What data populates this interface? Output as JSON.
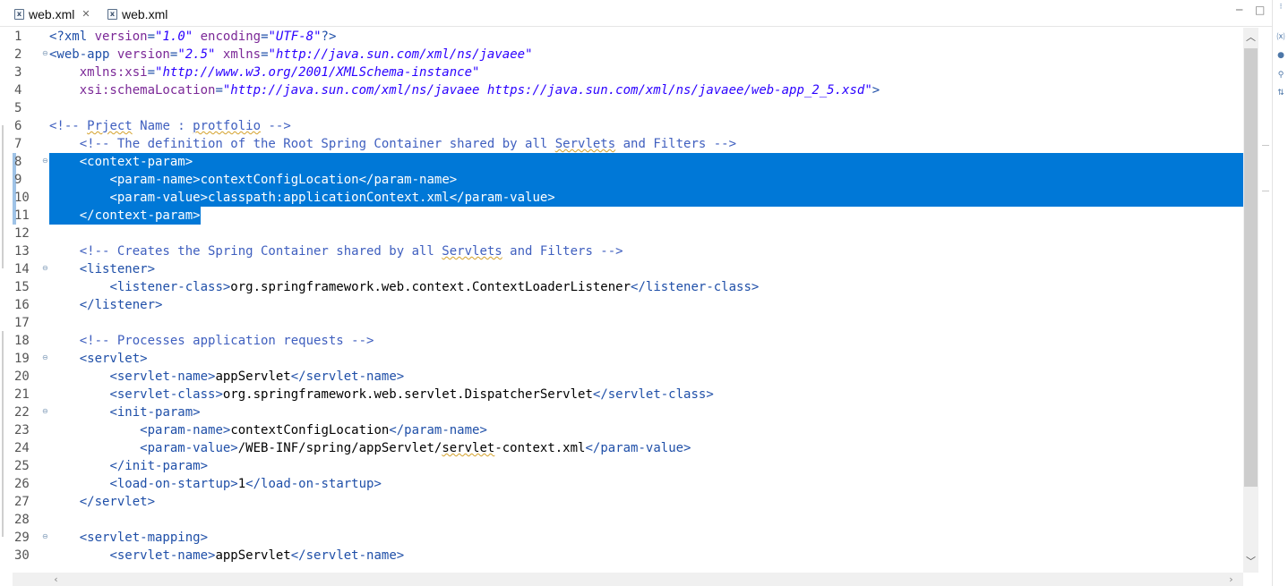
{
  "tabs": [
    {
      "label": "web.xml",
      "active": true,
      "close_icon": "✕"
    },
    {
      "label": "web.xml",
      "active": false
    }
  ],
  "window_controls": {
    "minimize": "─",
    "maximize": "□"
  },
  "editor": {
    "selection_color": "#0078d7",
    "lines": [
      {
        "num": "1",
        "fold": false,
        "selected": false,
        "tokens": [
          [
            "tag",
            "<?xml "
          ],
          [
            "attr",
            "version"
          ],
          [
            "tag",
            "="
          ],
          [
            "val",
            "\"1.0\""
          ],
          [
            "tag",
            " "
          ],
          [
            "attr",
            "encoding"
          ],
          [
            "tag",
            "="
          ],
          [
            "val",
            "\"UTF-8\""
          ],
          [
            "tag",
            "?>"
          ]
        ]
      },
      {
        "num": "2",
        "fold": true,
        "selected": false,
        "tokens": [
          [
            "tag",
            "<web-app "
          ],
          [
            "attr",
            "version"
          ],
          [
            "tag",
            "="
          ],
          [
            "val",
            "\"2.5\""
          ],
          [
            "tag",
            " "
          ],
          [
            "attr",
            "xmlns"
          ],
          [
            "tag",
            "="
          ],
          [
            "val",
            "\"http://java.sun.com/xml/ns/javaee\""
          ]
        ]
      },
      {
        "num": "3",
        "fold": false,
        "selected": false,
        "tokens": [
          [
            "txt",
            "    "
          ],
          [
            "attr",
            "xmlns:xsi"
          ],
          [
            "tag",
            "="
          ],
          [
            "val",
            "\"http://www.w3.org/2001/XMLSchema-instance\""
          ]
        ]
      },
      {
        "num": "4",
        "fold": false,
        "selected": false,
        "tokens": [
          [
            "txt",
            "    "
          ],
          [
            "attr",
            "xsi:schemaLocation"
          ],
          [
            "tag",
            "="
          ],
          [
            "val",
            "\"http://java.sun.com/xml/ns/javaee https://java.sun.com/xml/ns/javaee/web-app_2_5.xsd\""
          ],
          [
            "tag",
            ">"
          ]
        ]
      },
      {
        "num": "5",
        "fold": false,
        "selected": false,
        "tokens": []
      },
      {
        "num": "6",
        "fold": false,
        "selected": false,
        "tokens": [
          [
            "cmt",
            "<!-- "
          ],
          [
            "cmt-sq",
            "Prject"
          ],
          [
            "cmt",
            " Name : "
          ],
          [
            "cmt-sq",
            "protfolio"
          ],
          [
            "cmt",
            " -->"
          ]
        ]
      },
      {
        "num": "7",
        "fold": false,
        "selected": false,
        "tokens": [
          [
            "cmt",
            "    <!-- The definition of the Root Spring Container shared by all "
          ],
          [
            "cmt-sq",
            "Servlets"
          ],
          [
            "cmt",
            " and Filters -->"
          ]
        ]
      },
      {
        "num": "8",
        "fold": true,
        "selected": true,
        "marker": true,
        "tokens": [
          [
            "txt",
            "    "
          ],
          [
            "tag",
            "<context-param>"
          ]
        ]
      },
      {
        "num": "9",
        "fold": false,
        "selected": true,
        "marker": true,
        "tokens": [
          [
            "txt",
            "        "
          ],
          [
            "tag",
            "<param-name>"
          ],
          [
            "txt",
            "contextConfigLocation"
          ],
          [
            "tag",
            "</param-name>"
          ]
        ]
      },
      {
        "num": "10",
        "fold": false,
        "selected": true,
        "marker": true,
        "tokens": [
          [
            "txt",
            "        "
          ],
          [
            "tag",
            "<param-value>"
          ],
          [
            "txt",
            "classpath:applicationContext.xml"
          ],
          [
            "tag",
            "</param-value>"
          ]
        ]
      },
      {
        "num": "11",
        "fold": false,
        "selected": true,
        "partial": true,
        "marker": true,
        "tokens": [
          [
            "txt",
            "    "
          ],
          [
            "tag",
            "</context-param>"
          ]
        ]
      },
      {
        "num": "12",
        "fold": false,
        "selected": false,
        "tokens": []
      },
      {
        "num": "13",
        "fold": false,
        "selected": false,
        "tokens": [
          [
            "cmt",
            "    <!-- Creates the Spring Container shared by all "
          ],
          [
            "cmt-sq",
            "Servlets"
          ],
          [
            "cmt",
            " and Filters -->"
          ]
        ]
      },
      {
        "num": "14",
        "fold": true,
        "selected": false,
        "tokens": [
          [
            "txt",
            "    "
          ],
          [
            "tag",
            "<listener>"
          ]
        ]
      },
      {
        "num": "15",
        "fold": false,
        "selected": false,
        "tokens": [
          [
            "txt",
            "        "
          ],
          [
            "tag",
            "<listener-class>"
          ],
          [
            "txt",
            "org.springframework.web.context.ContextLoaderListener"
          ],
          [
            "tag",
            "</listener-class>"
          ]
        ]
      },
      {
        "num": "16",
        "fold": false,
        "selected": false,
        "tokens": [
          [
            "txt",
            "    "
          ],
          [
            "tag",
            "</listener>"
          ]
        ]
      },
      {
        "num": "17",
        "fold": false,
        "selected": false,
        "tokens": []
      },
      {
        "num": "18",
        "fold": false,
        "selected": false,
        "tokens": [
          [
            "cmt",
            "    <!-- Processes application requests -->"
          ]
        ]
      },
      {
        "num": "19",
        "fold": true,
        "selected": false,
        "tokens": [
          [
            "txt",
            "    "
          ],
          [
            "tag",
            "<servlet>"
          ]
        ]
      },
      {
        "num": "20",
        "fold": false,
        "selected": false,
        "tokens": [
          [
            "txt",
            "        "
          ],
          [
            "tag",
            "<servlet-name>"
          ],
          [
            "txt",
            "appServlet"
          ],
          [
            "tag",
            "</servlet-name>"
          ]
        ]
      },
      {
        "num": "21",
        "fold": false,
        "selected": false,
        "tokens": [
          [
            "txt",
            "        "
          ],
          [
            "tag",
            "<servlet-class>"
          ],
          [
            "txt",
            "org.springframework.web.servlet.DispatcherServlet"
          ],
          [
            "tag",
            "</servlet-class>"
          ]
        ]
      },
      {
        "num": "22",
        "fold": true,
        "selected": false,
        "tokens": [
          [
            "txt",
            "        "
          ],
          [
            "tag",
            "<init-param>"
          ]
        ]
      },
      {
        "num": "23",
        "fold": false,
        "selected": false,
        "tokens": [
          [
            "txt",
            "            "
          ],
          [
            "tag",
            "<param-name>"
          ],
          [
            "txt",
            "contextConfigLocation"
          ],
          [
            "tag",
            "</param-name>"
          ]
        ]
      },
      {
        "num": "24",
        "fold": false,
        "selected": false,
        "tokens": [
          [
            "txt",
            "            "
          ],
          [
            "tag",
            "<param-value>"
          ],
          [
            "txt",
            "/WEB-INF/spring/appServlet/"
          ],
          [
            "txt-sq",
            "servlet"
          ],
          [
            "txt",
            "-context.xml"
          ],
          [
            "tag",
            "</param-value>"
          ]
        ]
      },
      {
        "num": "25",
        "fold": false,
        "selected": false,
        "tokens": [
          [
            "txt",
            "        "
          ],
          [
            "tag",
            "</init-param>"
          ]
        ]
      },
      {
        "num": "26",
        "fold": false,
        "selected": false,
        "tokens": [
          [
            "txt",
            "        "
          ],
          [
            "tag",
            "<load-on-startup>"
          ],
          [
            "txt",
            "1"
          ],
          [
            "tag",
            "</load-on-startup>"
          ]
        ]
      },
      {
        "num": "27",
        "fold": false,
        "selected": false,
        "tokens": [
          [
            "txt",
            "    "
          ],
          [
            "tag",
            "</servlet>"
          ]
        ]
      },
      {
        "num": "28",
        "fold": false,
        "selected": false,
        "tokens": []
      },
      {
        "num": "29",
        "fold": true,
        "selected": false,
        "tokens": [
          [
            "txt",
            "    "
          ],
          [
            "tag",
            "<servlet-mapping>"
          ]
        ]
      },
      {
        "num": "30",
        "fold": false,
        "selected": false,
        "tokens": [
          [
            "txt",
            "        "
          ],
          [
            "tag",
            "<servlet-name>"
          ],
          [
            "txt",
            "appServlet"
          ],
          [
            "tag",
            "</servlet-name>"
          ]
        ]
      }
    ]
  },
  "icons": {
    "file": "xml-file-icon",
    "fold": "fold-collapse-icon",
    "scroll_up": "chevron-up-icon",
    "scroll_down": "chevron-down-icon",
    "scroll_left": "chevron-left-icon",
    "scroll_right": "chevron-right-icon"
  }
}
